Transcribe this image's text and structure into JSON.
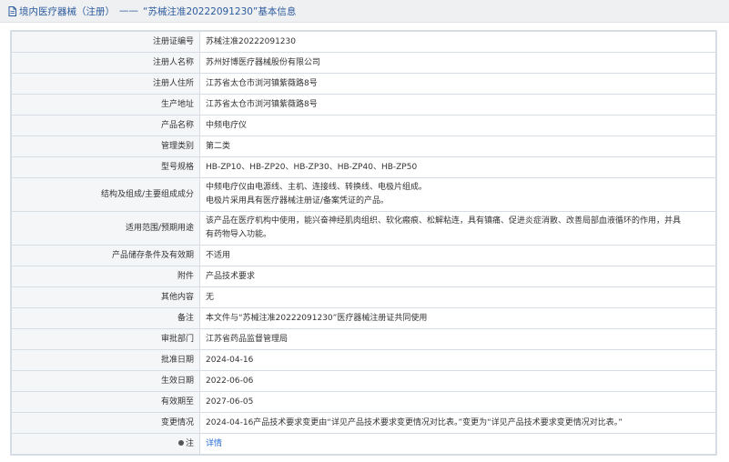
{
  "header": {
    "breadcrumb_root": "境内医疗器械（注册）",
    "separator": "——",
    "title": "“苏械注准20222091230”基本信息"
  },
  "rows": [
    {
      "label": "注册证编号",
      "value": "苏械注准20222091230"
    },
    {
      "label": "注册人名称",
      "value": "苏州好博医疗器械股份有限公司"
    },
    {
      "label": "注册人住所",
      "value": "江苏省太仓市浏河镇紫薇路8号"
    },
    {
      "label": "生产地址",
      "value": "江苏省太仓市浏河镇紫薇路8号"
    },
    {
      "label": "产品名称",
      "value": "中频电疗仪"
    },
    {
      "label": "管理类别",
      "value": "第二类"
    },
    {
      "label": "型号规格",
      "value": "HB-ZP10、HB-ZP20、HB-ZP30、HB-ZP40、HB-ZP50"
    },
    {
      "label": "结构及组成/主要组成成分",
      "value_line1": "中频电疗仪由电源线、主机、连接线、转换线、电极片组成。",
      "value_line2": "电极片采用具有医疗器械注册证/备案凭证的产品。"
    },
    {
      "label": "适用范围/预期用途",
      "value_line1": "该产品在医疗机构中使用，能兴奋神经肌肉组织、软化瘢痕、松解粘连，具有镇痛、促进炎症消散、改善局部血液循环的作用，并具",
      "value_line2": "有药物导入功能。"
    },
    {
      "label": "产品储存条件及有效期",
      "value": "不适用"
    },
    {
      "label": "附件",
      "value": "产品技术要求"
    },
    {
      "label": "其他内容",
      "value": "无"
    },
    {
      "label": "备注",
      "value": "本文件与“苏械注准20222091230”医疗器械注册证共同使用"
    },
    {
      "label": "审批部门",
      "value": "江苏省药品监督管理局"
    },
    {
      "label": "批准日期",
      "value": "2024-04-16"
    },
    {
      "label": "生效日期",
      "value": "2022-06-06"
    },
    {
      "label": "有效期至",
      "value": "2027-06-05"
    },
    {
      "label": "变更情况",
      "value": "2024-04-16产品技术要求变更由“详见产品技术要求变更情况对比表。”变更为“详见产品技术要求变更情况对比表。”"
    },
    {
      "label": "注",
      "value": "详情"
    }
  ],
  "icons": {
    "header": "document-icon",
    "note": "info-icon"
  },
  "colors": {
    "header_text": "#2d5b9e",
    "label_bg": "#f4f6f8",
    "border": "#d7dde4",
    "link": "#2a6fd6"
  }
}
